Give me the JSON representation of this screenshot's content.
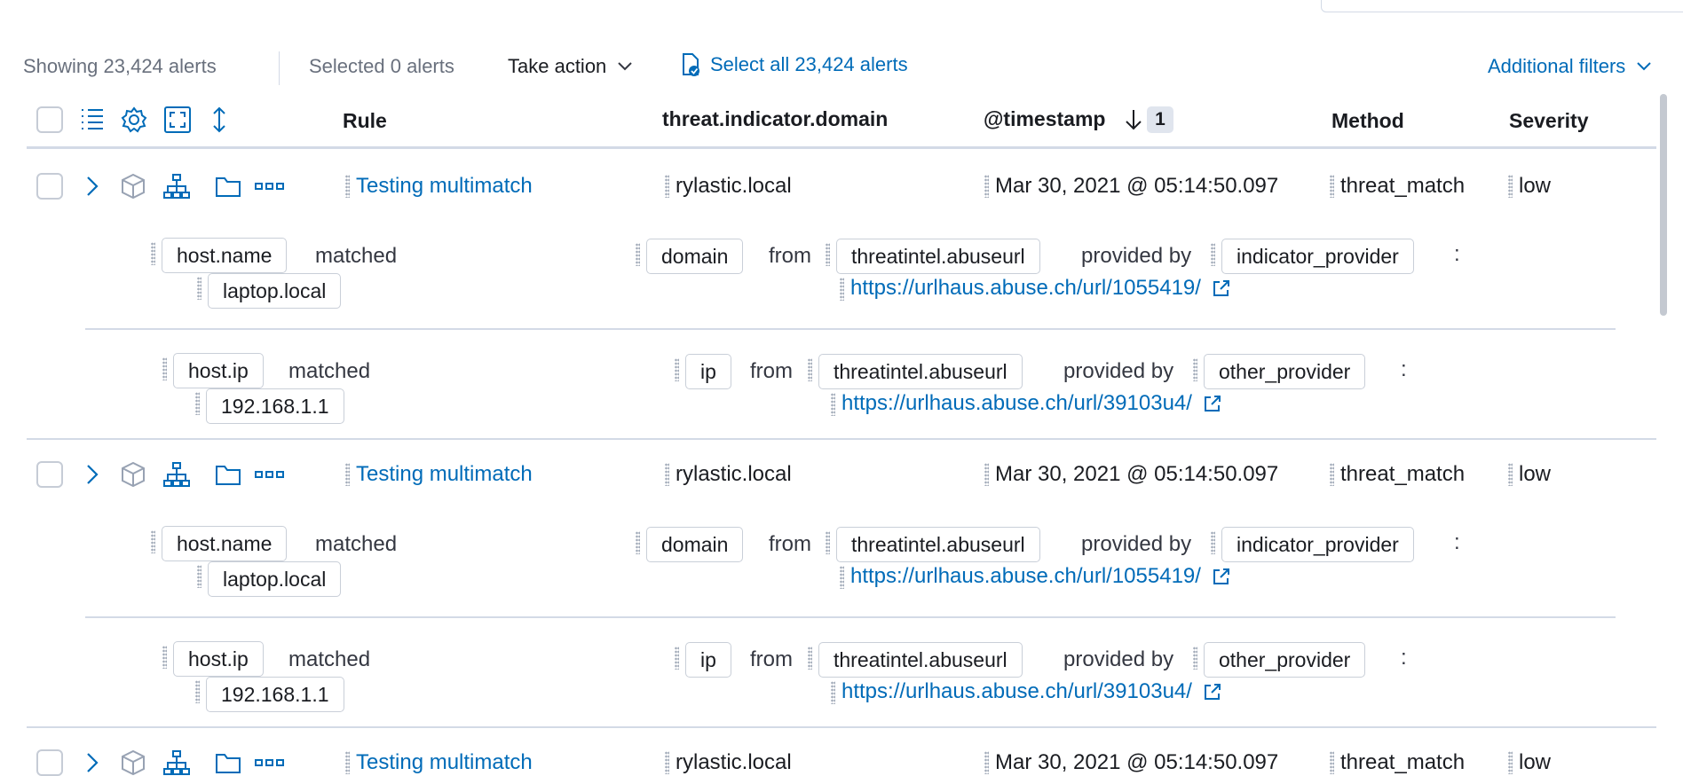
{
  "toolbar": {
    "showing": "Showing 23,424 alerts",
    "selected": "Selected 0 alerts",
    "take_action": "Take action",
    "select_all": "Select all 23,424 alerts",
    "additional_filters": "Additional filters"
  },
  "columns": {
    "rule": "Rule",
    "domain": "threat.indicator.domain",
    "timestamp": "@timestamp",
    "sort_count": "1",
    "method": "Method",
    "severity": "Severity"
  },
  "rows": [
    {
      "rule": "Testing multimatch",
      "domain": "rylastic.local",
      "timestamp": "Mar 30, 2021 @ 05:14:50.097",
      "method": "threat_match",
      "severity": "low",
      "matches": [
        {
          "field": "host.name",
          "matched_word": "matched",
          "value": "laptop.local",
          "indicator_type": "domain",
          "from_word": "from",
          "source": "threatintel.abuseurl",
          "provided_by_word": "provided by",
          "provider": "indicator_provider",
          "colon": ":",
          "url": "https://urlhaus.abuse.ch/url/1055419/"
        },
        {
          "field": "host.ip",
          "matched_word": "matched",
          "value": "192.168.1.1",
          "indicator_type": "ip",
          "from_word": "from",
          "source": "threatintel.abuseurl",
          "provided_by_word": "provided by",
          "provider": "other_provider",
          "colon": ":",
          "url": "https://urlhaus.abuse.ch/url/39103u4/"
        }
      ]
    },
    {
      "rule": "Testing multimatch",
      "domain": "rylastic.local",
      "timestamp": "Mar 30, 2021 @ 05:14:50.097",
      "method": "threat_match",
      "severity": "low",
      "matches": [
        {
          "field": "host.name",
          "matched_word": "matched",
          "value": "laptop.local",
          "indicator_type": "domain",
          "from_word": "from",
          "source": "threatintel.abuseurl",
          "provided_by_word": "provided by",
          "provider": "indicator_provider",
          "colon": ":",
          "url": "https://urlhaus.abuse.ch/url/1055419/"
        },
        {
          "field": "host.ip",
          "matched_word": "matched",
          "value": "192.168.1.1",
          "indicator_type": "ip",
          "from_word": "from",
          "source": "threatintel.abuseurl",
          "provided_by_word": "provided by",
          "provider": "other_provider",
          "colon": ":",
          "url": "https://urlhaus.abuse.ch/url/39103u4/"
        }
      ]
    },
    {
      "rule": "Testing multimatch",
      "domain": "rylastic.local",
      "timestamp": "Mar 30, 2021 @ 05:14:50.097",
      "method": "threat_match",
      "severity": "low"
    }
  ],
  "colors": {
    "link": "#006bb8",
    "text": "#343741",
    "border": "#d3dae6"
  }
}
